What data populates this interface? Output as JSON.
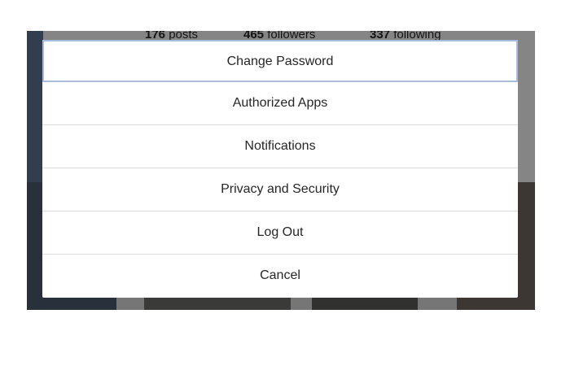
{
  "profile": {
    "posts_count": "176",
    "posts_label": " posts",
    "followers_count": "465",
    "followers_label": " followers",
    "following_count": "337",
    "following_label": " following"
  },
  "options_menu": {
    "items": [
      {
        "label": "Change Password"
      },
      {
        "label": "Authorized Apps"
      },
      {
        "label": "Notifications"
      },
      {
        "label": "Privacy and Security"
      },
      {
        "label": "Log Out"
      },
      {
        "label": "Cancel"
      }
    ]
  },
  "colors": {
    "focus_outline": "#a9bbdc",
    "divider": "#dbdbdb",
    "text": "#262626"
  }
}
